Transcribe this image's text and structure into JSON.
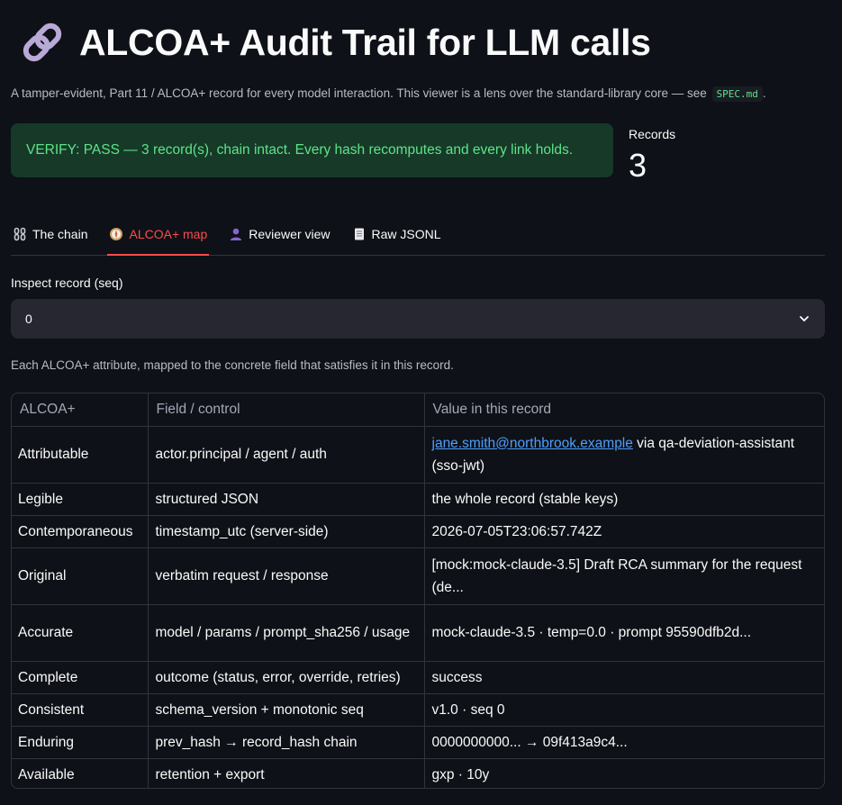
{
  "header": {
    "title": "ALCOA+ Audit Trail for LLM calls",
    "subtitle_text": "A tamper-evident, Part 11 / ALCOA+ record for every model interaction. This viewer is a lens over the standard-library core — see",
    "subtitle_code": "SPEC.md",
    "subtitle_end": "."
  },
  "verify": {
    "message": "VERIFY: PASS — 3 record(s), chain intact. Every hash recomputes and every link holds."
  },
  "metric": {
    "label": "Records",
    "value": "3"
  },
  "tabs": [
    {
      "label": "The chain",
      "icon": "chain-icon",
      "active": false
    },
    {
      "label": "ALCOA+ map",
      "icon": "compass-icon",
      "active": true
    },
    {
      "label": "Reviewer view",
      "icon": "person-icon",
      "active": false
    },
    {
      "label": "Raw JSONL",
      "icon": "document-icon",
      "active": false
    }
  ],
  "inspect": {
    "label": "Inspect record (seq)",
    "selected": "0"
  },
  "caption": "Each ALCOA+ attribute, mapped to the concrete field that satisfies it in this record.",
  "table": {
    "columns": [
      "ALCOA+",
      "Field / control",
      "Value in this record"
    ],
    "rows": [
      {
        "attr": "Attributable",
        "field": "actor.principal / agent / auth",
        "value_link": "jane.smith@northbrook.example",
        "value": " via qa-deviation-assistant (sso-jwt)"
      },
      {
        "attr": "Legible",
        "field": "structured JSON",
        "value": "the whole record (stable keys)"
      },
      {
        "attr": "Contemporaneous",
        "field": "timestamp_utc (server-side)",
        "value": "2026-07-05T23:06:57.742Z"
      },
      {
        "attr": "Original",
        "field": "verbatim request / response",
        "value": "[mock:mock-claude-3.5] Draft RCA summary for the request (de..."
      },
      {
        "attr": "Accurate",
        "field": "model / params / prompt_sha256 / usage",
        "value": "mock-claude-3.5 · temp=0.0 · prompt 95590dfb2d..."
      },
      {
        "attr": "Complete",
        "field": "outcome (status, error, override, retries)",
        "value": "success"
      },
      {
        "attr": "Consistent",
        "field": "schema_version + monotonic seq",
        "value": "v1.0 · seq 0"
      },
      {
        "attr": "Enduring",
        "field": "prev_hash → record_hash chain",
        "value": "0000000000... → 09f413a9c4..."
      },
      {
        "attr": "Available",
        "field": "retention + export",
        "value": "gxp · 10y"
      }
    ]
  },
  "colors": {
    "accent": "#ff4b4b",
    "success_text": "#5ce488",
    "success_bg": "#173928",
    "link": "#4d9fff"
  }
}
